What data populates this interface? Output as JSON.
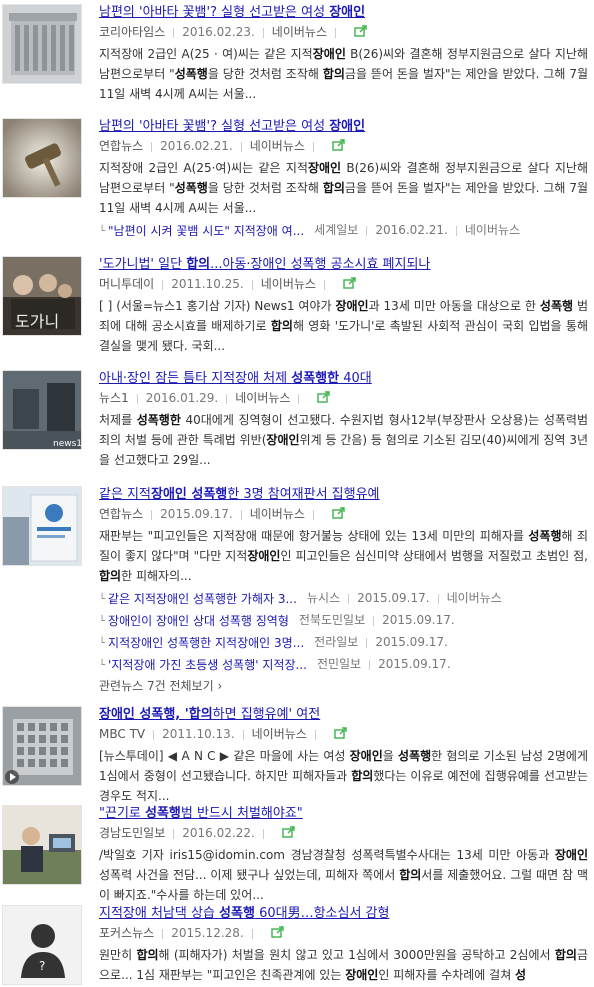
{
  "items": [
    {
      "title_pre": "남편의 '아바타 꽃뱀'? 실형 선고받은 여성 ",
      "title_bold": "장애인",
      "title_post": "",
      "press": "코리아타임스",
      "date": "2016.02.23.",
      "naver": "네이버뉴스",
      "desc_parts": [
        [
          "지적장애 2급인 A(25 · 여)씨는 같은 지적",
          ""
        ],
        [
          "장애인",
          "b"
        ],
        [
          " B(26)씨와 결혼해 정부지원금으로 살다 지난해 남편으로부터 \"",
          ""
        ],
        [
          "성폭행",
          "b"
        ],
        [
          "을 당한 것처럼 조작해 ",
          ""
        ],
        [
          "합의",
          "b"
        ],
        [
          "금을 뜯어 돈을 벌자\"는 제안을 받았다. 그해 7월 11일 새벽 4시께 A씨는 서울...",
          ""
        ]
      ],
      "thumb": "court"
    },
    {
      "title_pre": "남편의 '아바타 꽃뱀'? 실형 선고받은 여성 ",
      "title_bold": "장애인",
      "title_post": "",
      "press": "연합뉴스",
      "date": "2016.02.21.",
      "naver": "네이버뉴스",
      "desc_parts": [
        [
          "지적장애 2급인 A(25·여)씨는 같은 지적",
          ""
        ],
        [
          "장애인",
          "b"
        ],
        [
          " B(26)씨와 결혼해 정부지원금으로 살다 지난해 남편으로부터 \"",
          ""
        ],
        [
          "성폭행",
          "b"
        ],
        [
          "을 당한 것처럼 조작해 ",
          ""
        ],
        [
          "합의",
          "b"
        ],
        [
          "금을 뜯어 돈을 벌자\"는 제안을 받았다. 그해 7월 11일 새벽 4시께 A씨는 서울...",
          ""
        ]
      ],
      "related": [
        {
          "title": "\"남편이 시켜 꽃뱀 시도\" 지적장애 여...",
          "press": "세계일보",
          "date": "2016.02.21.",
          "naver": "네이버뉴스"
        }
      ],
      "thumb": "gavel"
    },
    {
      "title_pre": "'도가니법' 일단 ",
      "title_bold": "합의",
      "title_post": "...아동·장애인 성폭행 공소시효 폐지되나",
      "press": "머니투데이",
      "date": "2011.10.25.",
      "naver": "네이버뉴스",
      "desc_parts": [
        [
          "[ ] (서울=뉴스1 홍기삼 기자) News1 여야가 ",
          ""
        ],
        [
          "장애인",
          "b"
        ],
        [
          "과 13세 미만 아동을 대상으로 한 ",
          ""
        ],
        [
          "성폭행",
          "b"
        ],
        [
          " 범죄에 대해 공소시효를 배제하기로 ",
          ""
        ],
        [
          "합의",
          "b"
        ],
        [
          "해 영화 '도가니'로 촉발된 사회적 관심이 국회 입법을 통해 결실을 맺게 됐다. 국회...",
          ""
        ]
      ],
      "thumb": "movie"
    },
    {
      "title_pre": "아내·장인 잠든 틈타 지적장애 처제 ",
      "title_bold": "성폭행한",
      "title_post": " 40대",
      "press": "뉴스1",
      "date": "2016.01.29.",
      "naver": "네이버뉴스",
      "desc_parts": [
        [
          "처제를 ",
          ""
        ],
        [
          "성폭행한",
          "b"
        ],
        [
          " 40대에게 징역형이 선고됐다. 수원지법 형사12부(부장판사 오상용)는 성폭력범죄의 처벌 등에 관한 특례법 위반(",
          ""
        ],
        [
          "장애인",
          "b"
        ],
        [
          "위계 등 간음) 등 혐의로 기소된 김모(40)씨에게 징역 3년을 선고했다고 29일...",
          ""
        ]
      ],
      "thumb": "news1"
    },
    {
      "title_pre": "같은 지적",
      "title_bold": "장애인 성폭행",
      "title_post": "한 3명 참여재판서 집행유예",
      "press": "연합뉴스",
      "date": "2015.09.17.",
      "naver": "네이버뉴스",
      "desc_parts": [
        [
          "재판부는 \"피고인들은 지적장애 때문에 항거불능 상태에 있는 13세 미만의 피해자를 ",
          ""
        ],
        [
          "성폭행",
          "b"
        ],
        [
          "해 죄질이 좋지 않다\"며 \"다만 지적",
          ""
        ],
        [
          "장애인",
          "b"
        ],
        [
          "인 피고인들은 심신미약 상태에서 범행을 저질렀고 초범인 점, ",
          ""
        ],
        [
          "합의",
          "b"
        ],
        [
          "한 피해자의...",
          ""
        ]
      ],
      "related": [
        {
          "title": "같은 지적장애인 성폭행한 가해자 3...",
          "press": "뉴시스",
          "date": "2015.09.17.",
          "naver": "네이버뉴스"
        },
        {
          "title": "장애인이 장애인 상대 성폭행 징역형",
          "press": "전북도민일보",
          "date": "2015.09.17.",
          "naver": ""
        },
        {
          "title": "지적장애인 성폭행한 지적장애인 3명...",
          "press": "전라일보",
          "date": "2015.09.17.",
          "naver": ""
        },
        {
          "title": "'지적장애 가진 초등생 성폭행' 지적장...",
          "press": "전민일보",
          "date": "2015.09.17.",
          "naver": ""
        }
      ],
      "more": "관련뉴스 7건 전체보기",
      "thumb": "court2"
    },
    {
      "title_pre": "",
      "title_bold": "장애인 성폭행, '합의",
      "title_post": "하면 집행유예' 여전",
      "press": "MBC TV",
      "date": "2011.10.13.",
      "naver": "네이버뉴스",
      "desc_parts": [
        [
          "[뉴스투데이] ◀ A N C ▶ 같은 마을에 사는 여성 ",
          ""
        ],
        [
          "장애인",
          "b"
        ],
        [
          "을 ",
          ""
        ],
        [
          "성폭행",
          "b"
        ],
        [
          "한 혐의로 기소된 남성 2명에게 1심에서 중형이 선고됐습니다. 하지만 피해자들과 ",
          ""
        ],
        [
          "합의",
          "b"
        ],
        [
          "했다는 이유로 예전에 집행유예를 선고받는 경우도 적지...",
          ""
        ]
      ],
      "thumb": "building"
    },
    {
      "title_pre": "\"끈기로 ",
      "title_bold": "성폭행",
      "title_post": "범 반드시 처벌해야죠\"",
      "press": "경남도민일보",
      "date": "2016.02.22.",
      "naver": "",
      "desc_parts": [
        [
          "/박일호 기자 iris15@idomin.com 경남경찰청 성폭력특별수사대는 13세 미만 아동과 ",
          ""
        ],
        [
          "장애인",
          "b"
        ],
        [
          " 성폭력 사건을 전담... 이제 됐구나 싶었는데, 피해자 쪽에서 ",
          ""
        ],
        [
          "합의",
          "b"
        ],
        [
          "서를 제출했어요. 그럴 때면 참 맥이 빠지죠.\"수사를 하는데 있어...",
          ""
        ]
      ],
      "thumb": "office"
    },
    {
      "title_pre": "지적장애 처남댁 상습 ",
      "title_bold": "성폭행",
      "title_post": " 60대男…항소심서 감형",
      "press": "포커스뉴스",
      "date": "2015.12.28.",
      "naver": "",
      "desc_parts": [
        [
          "원만히 ",
          ""
        ],
        [
          "합의",
          "b"
        ],
        [
          "해 (피해자가) 처벌을 원치 않고 있고 1심에서 3000만원을 공탁하고 2심에서 ",
          ""
        ],
        [
          "합의",
          "b"
        ],
        [
          "금으로... 1심 재판부는 \"피고인은 친족관계에 있는 ",
          ""
        ],
        [
          "장애인",
          "b"
        ],
        [
          "인 피해자를 수차례에 걸쳐 ",
          ""
        ],
        [
          "성",
          "b"
        ]
      ],
      "thumb": "silhouette"
    }
  ],
  "colors": {
    "link": "#1c1ab3",
    "ext_icon": "#3cb44b"
  }
}
